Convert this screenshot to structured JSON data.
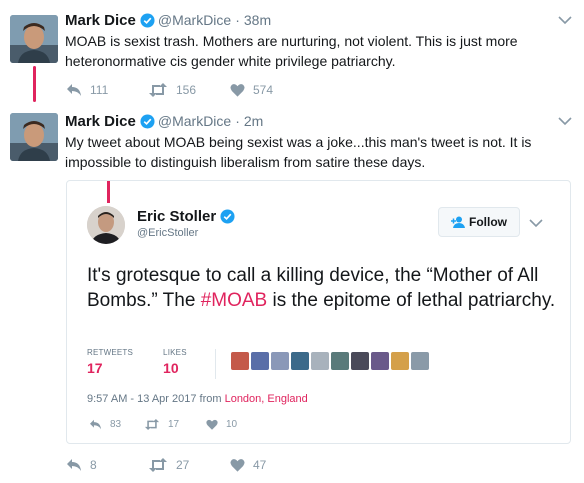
{
  "tweet1": {
    "name": "Mark Dice",
    "handle": "@MarkDice",
    "separator": "·",
    "time": "38m",
    "text": "MOAB is sexist trash. Mothers are nurturing, not violent.  This is just more heteronormative cis gender white privilege patriarchy.",
    "replies": "111",
    "retweets": "156",
    "likes": "574"
  },
  "tweet2": {
    "name": "Mark Dice",
    "handle": "@MarkDice",
    "separator": "·",
    "time": "2m",
    "text": "My tweet about MOAB being sexist was a joke...this man's tweet is not.  It is impossible to distinguish liberalism from satire these days.",
    "replies": "8",
    "retweets": "27",
    "likes": "47"
  },
  "quoted": {
    "name": "Eric Stoller",
    "handle": "@EricStoller",
    "follow_label": "Follow",
    "text_before": "It's grotesque to call a killing device, the “Mother of All Bombs.” The ",
    "hashtag": "#MOAB",
    "text_after": " is the epitome of lethal patriarchy.",
    "retweets_label": "RETWEETS",
    "retweets_count": "17",
    "likes_label": "LIKES",
    "likes_count": "10",
    "date": "9:57 AM - 13 Apr 2017 from ",
    "location": "London, England",
    "replies": "83",
    "retweets": "17",
    "likes": "10"
  },
  "colors": {
    "accent": "#e0245e",
    "verified": "#1da1f2",
    "muted": "#657786"
  }
}
